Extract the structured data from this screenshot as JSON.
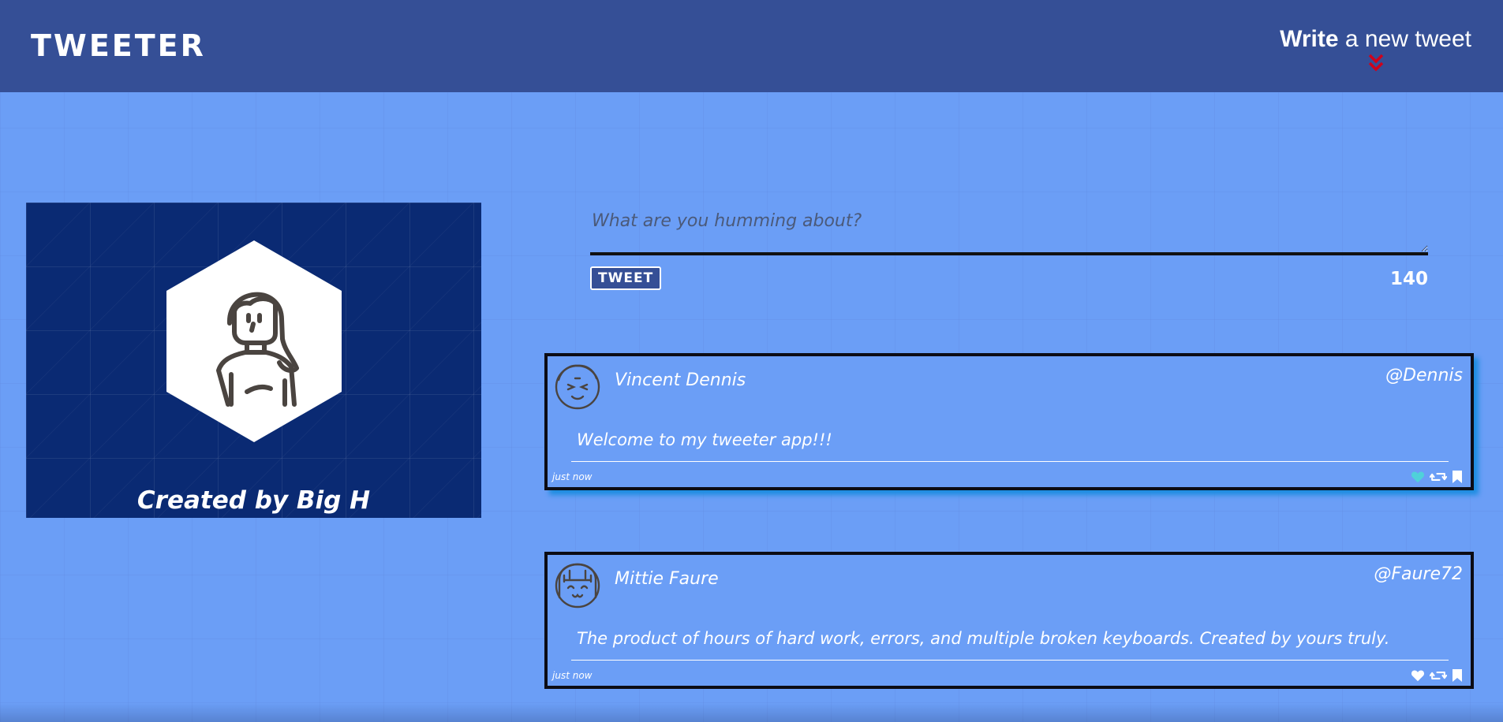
{
  "nav": {
    "brand": "TWEETER",
    "compose_toggle": {
      "bold_word": "Write",
      "rest": "a new tweet",
      "icon": "double-chevron-down-icon"
    }
  },
  "profile": {
    "caption": "Created by Big H",
    "icon": "user-avatar-icon"
  },
  "composer": {
    "placeholder": "What are you humming about?",
    "value": "",
    "submit_label": "TWEET",
    "counter": "140"
  },
  "tweets": [
    {
      "name": "Vincent Dennis",
      "handle": "@Dennis",
      "content": "Welcome to my tweeter app!!!",
      "time": "just now",
      "liked": true,
      "avatar_icon": "male-avatar-icon"
    },
    {
      "name": "Mittie Faure",
      "handle": "@Faure72",
      "content": "The product of hours of hard work, errors, and multiple broken keyboards. Created by yours truly.",
      "time": "just now",
      "liked": false,
      "avatar_icon": "female-avatar-icon"
    }
  ],
  "colors": {
    "background": "#6b9ef6",
    "nav": "#354f96",
    "profile_bg": "#0a2a73",
    "accent_red": "#d0021b",
    "liked_heart": "#4fd1d9",
    "tweet_shadow": "#1d8de0"
  }
}
